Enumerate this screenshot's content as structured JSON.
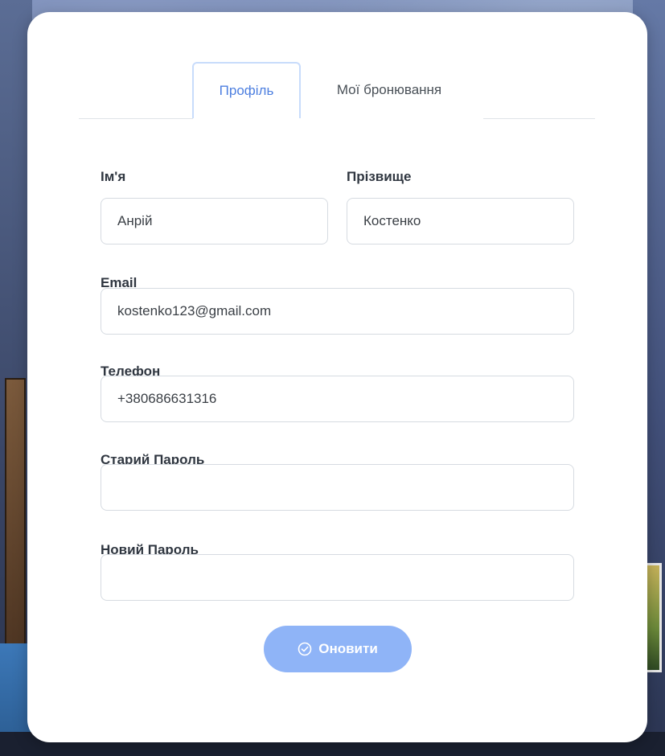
{
  "tabs": [
    {
      "label": "Профіль",
      "active": true
    },
    {
      "label": "Мої бронювання",
      "active": false
    }
  ],
  "form": {
    "first_name": {
      "label": "Ім'я",
      "value": "Анрій"
    },
    "last_name": {
      "label": "Прізвище",
      "value": "Костенко"
    },
    "email": {
      "label": "Email",
      "value": "kostenko123@gmail.com"
    },
    "phone": {
      "label": "Телефон",
      "value": "+380686631316"
    },
    "old_password": {
      "label": "Старий Пароль",
      "value": ""
    },
    "new_password": {
      "label": "Новий Пароль",
      "value": ""
    }
  },
  "submit": {
    "label": "Оновити",
    "icon": "check-circle-icon"
  },
  "colors": {
    "accent": "#4d7fe0",
    "button": "#8fb4f7",
    "tab_border": "#c8dcfb",
    "input_border": "#d6dbe1"
  }
}
